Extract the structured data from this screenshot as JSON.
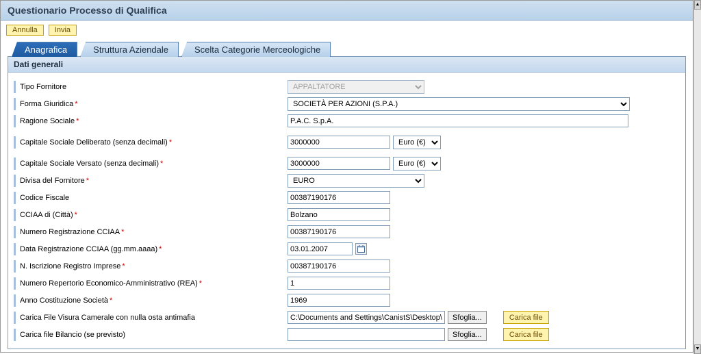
{
  "header": {
    "title": "Questionario Processo di Qualifica"
  },
  "buttons": {
    "annulla": "Annulla",
    "invia": "Invia"
  },
  "tabs": {
    "anagrafica": "Anagrafica",
    "struttura": "Struttura Aziendale",
    "scelta": "Scelta Categorie Merceologiche"
  },
  "section": {
    "header": "Dati generali"
  },
  "labels": {
    "tipo_fornitore": "Tipo Fornitore",
    "forma_giuridica": "Forma Giuridica",
    "ragione_sociale": "Ragione Sociale",
    "capitale_deliberato": "Capitale Sociale Deliberato (senza decimali)",
    "capitale_versato": "Capitale Sociale Versato (senza decimali)",
    "divisa_fornitore": "Divisa del Fornitore",
    "codice_fiscale": "Codice Fiscale",
    "cciaa_citta": "CCIAA di (Città)",
    "numero_reg_cciaa": "Numero Registrazione CCIAA",
    "data_reg_cciaa": "Data Registrazione CCIAA (gg.mm.aaaa)",
    "n_iscrizione": "N. Iscrizione Registro Imprese",
    "numero_rea": "Numero Repertorio Economico-Amministrativo (REA)",
    "anno_cost": "Anno Costituzione Società",
    "carica_visura": "Carica File Visura Camerale con nulla osta antimafia",
    "carica_bilancio": "Carica file Bilancio (se previsto)"
  },
  "values": {
    "tipo_fornitore": "APPALTATORE",
    "forma_giuridica": "SOCIETÀ PER AZIONI (S.P.A.)",
    "ragione_sociale": "P.A.C. S.p.A.",
    "capitale_deliberato": "3000000",
    "capitale_deliberato_curr": "Euro (€)",
    "capitale_versato": "3000000",
    "capitale_versato_curr": "Euro (€)",
    "divisa_fornitore": "EURO",
    "codice_fiscale": "00387190176",
    "cciaa_citta": "Bolzano",
    "numero_reg_cciaa": "00387190176",
    "data_reg_cciaa": "03.01.2007",
    "n_iscrizione": "00387190176",
    "numero_rea": "1",
    "anno_cost": "1969",
    "visura_path": "C:\\Documents and Settings\\CanistS\\Desktop\\So",
    "bilancio_path": ""
  },
  "file_buttons": {
    "sfoglia": "Sfoglia...",
    "carica": "Carica file"
  }
}
